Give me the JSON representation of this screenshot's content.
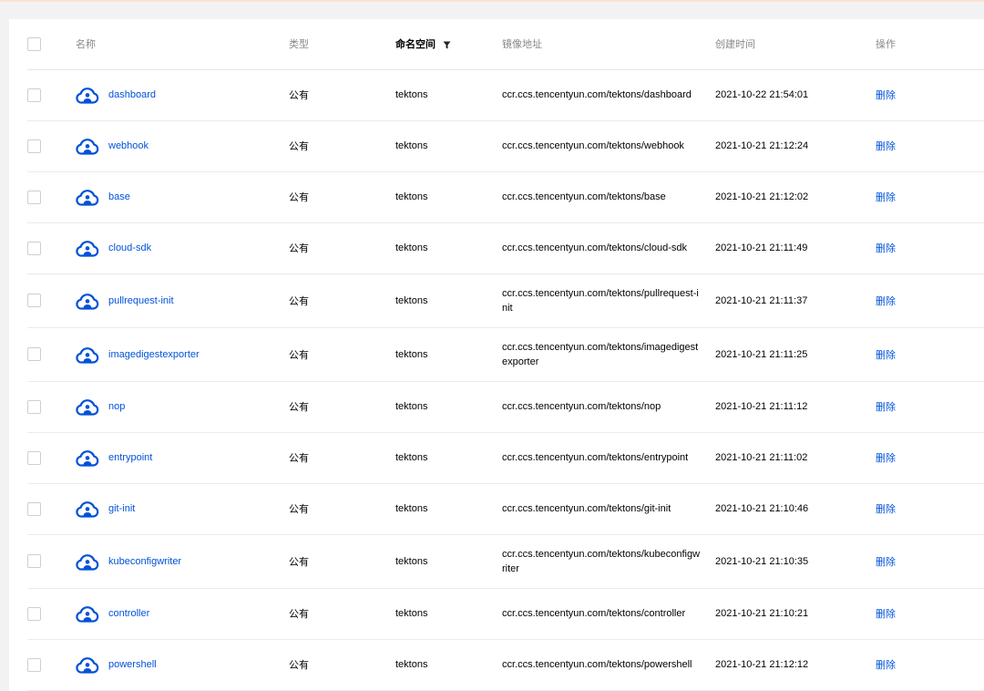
{
  "table": {
    "headers": {
      "name": "名称",
      "type": "类型",
      "namespace": "命名空间",
      "address": "镜像地址",
      "created": "创建时间",
      "action": "操作"
    },
    "rows": [
      {
        "name": "dashboard",
        "type": "公有",
        "namespace": "tektons",
        "address": "ccr.ccs.tencentyun.com/tektons/dashboard",
        "created": "2021-10-22 21:54:01",
        "action": "删除"
      },
      {
        "name": "webhook",
        "type": "公有",
        "namespace": "tektons",
        "address": "ccr.ccs.tencentyun.com/tektons/webhook",
        "created": "2021-10-21 21:12:24",
        "action": "删除"
      },
      {
        "name": "base",
        "type": "公有",
        "namespace": "tektons",
        "address": "ccr.ccs.tencentyun.com/tektons/base",
        "created": "2021-10-21 21:12:02",
        "action": "删除"
      },
      {
        "name": "cloud-sdk",
        "type": "公有",
        "namespace": "tektons",
        "address": "ccr.ccs.tencentyun.com/tektons/cloud-sdk",
        "created": "2021-10-21 21:11:49",
        "action": "删除"
      },
      {
        "name": "pullrequest-init",
        "type": "公有",
        "namespace": "tektons",
        "address": "ccr.ccs.tencentyun.com/tektons/pullrequest-init",
        "created": "2021-10-21 21:11:37",
        "action": "删除"
      },
      {
        "name": "imagedigestexporter",
        "type": "公有",
        "namespace": "tektons",
        "address": "ccr.ccs.tencentyun.com/tektons/imagedigestexporter",
        "created": "2021-10-21 21:11:25",
        "action": "删除"
      },
      {
        "name": "nop",
        "type": "公有",
        "namespace": "tektons",
        "address": "ccr.ccs.tencentyun.com/tektons/nop",
        "created": "2021-10-21 21:11:12",
        "action": "删除"
      },
      {
        "name": "entrypoint",
        "type": "公有",
        "namespace": "tektons",
        "address": "ccr.ccs.tencentyun.com/tektons/entrypoint",
        "created": "2021-10-21 21:11:02",
        "action": "删除"
      },
      {
        "name": "git-init",
        "type": "公有",
        "namespace": "tektons",
        "address": "ccr.ccs.tencentyun.com/tektons/git-init",
        "created": "2021-10-21 21:10:46",
        "action": "删除"
      },
      {
        "name": "kubeconfigwriter",
        "type": "公有",
        "namespace": "tektons",
        "address": "ccr.ccs.tencentyun.com/tektons/kubeconfigwriter",
        "created": "2021-10-21 21:10:35",
        "action": "删除"
      },
      {
        "name": "controller",
        "type": "公有",
        "namespace": "tektons",
        "address": "ccr.ccs.tencentyun.com/tektons/controller",
        "created": "2021-10-21 21:10:21",
        "action": "删除"
      },
      {
        "name": "powershell",
        "type": "公有",
        "namespace": "tektons",
        "address": "ccr.ccs.tencentyun.com/tektons/powershell",
        "created": "2021-10-21 21:12:12",
        "action": "删除"
      }
    ]
  },
  "icons": {
    "row_icon": "cloud-user-icon",
    "filter": "filter-icon"
  },
  "colors": {
    "link": "#0052d9",
    "header_text": "#888888",
    "top_bar": "#fbe3d6"
  }
}
